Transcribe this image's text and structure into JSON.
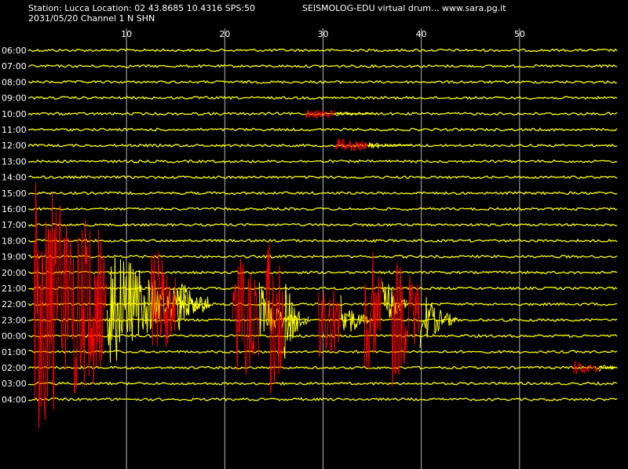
{
  "header": {
    "station_info": "Station: Lucca Location: 02 43.8685 10.4316 SPS:50",
    "app_title": "SEISMOLOG-EDU virtual drum... www.sara.pg.it",
    "date_channel": "2031/05/20  Channel 1 N SHN"
  },
  "colors": {
    "background": "#000000",
    "trace": "#ffff00",
    "event": "#ff0000",
    "gridline": "#b4b4b4",
    "text": "#ffffff"
  },
  "chart_data": {
    "type": "seismogram-drum",
    "x_unit": "minutes",
    "xlim": [
      0,
      60
    ],
    "x_ticks": [
      10,
      20,
      30,
      40,
      50
    ],
    "grid": true,
    "row_labels": [
      "06:00",
      "07:00",
      "08:00",
      "09:00",
      "10:00",
      "11:00",
      "12:00",
      "13:00",
      "14:00",
      "15:00",
      "16:00",
      "17:00",
      "18:00",
      "19:00",
      "20:00",
      "21:00",
      "22:00",
      "23:00",
      "00:00",
      "01:00",
      "02:00",
      "03:00",
      "04:00"
    ],
    "events": [
      {
        "row": "10:00",
        "start_min": 28.2,
        "end_min": 31.2,
        "amp": 0.4
      },
      {
        "row": "12:00",
        "start_min": 31.3,
        "end_min": 34.5,
        "amp": 0.5
      },
      {
        "row": "22:00",
        "start_min": 0.6,
        "end_min": 8.0,
        "amp": 9.0
      },
      {
        "row": "22:00",
        "start_min": 12.5,
        "end_min": 15.0,
        "amp": 4.5
      },
      {
        "row": "23:00",
        "start_min": 20.8,
        "end_min": 23.5,
        "amp": 5.0
      },
      {
        "row": "23:00",
        "start_min": 24.2,
        "end_min": 26.0,
        "amp": 6.0
      },
      {
        "row": "23:00",
        "start_min": 29.5,
        "end_min": 31.8,
        "amp": 3.5
      },
      {
        "row": "22:00",
        "start_min": 34.2,
        "end_min": 36.0,
        "amp": 5.5
      },
      {
        "row": "23:00",
        "start_min": 37.0,
        "end_min": 39.8,
        "amp": 4.5
      },
      {
        "row": "02:00",
        "start_min": 55.5,
        "end_min": 58.0,
        "amp": 0.5
      }
    ]
  }
}
